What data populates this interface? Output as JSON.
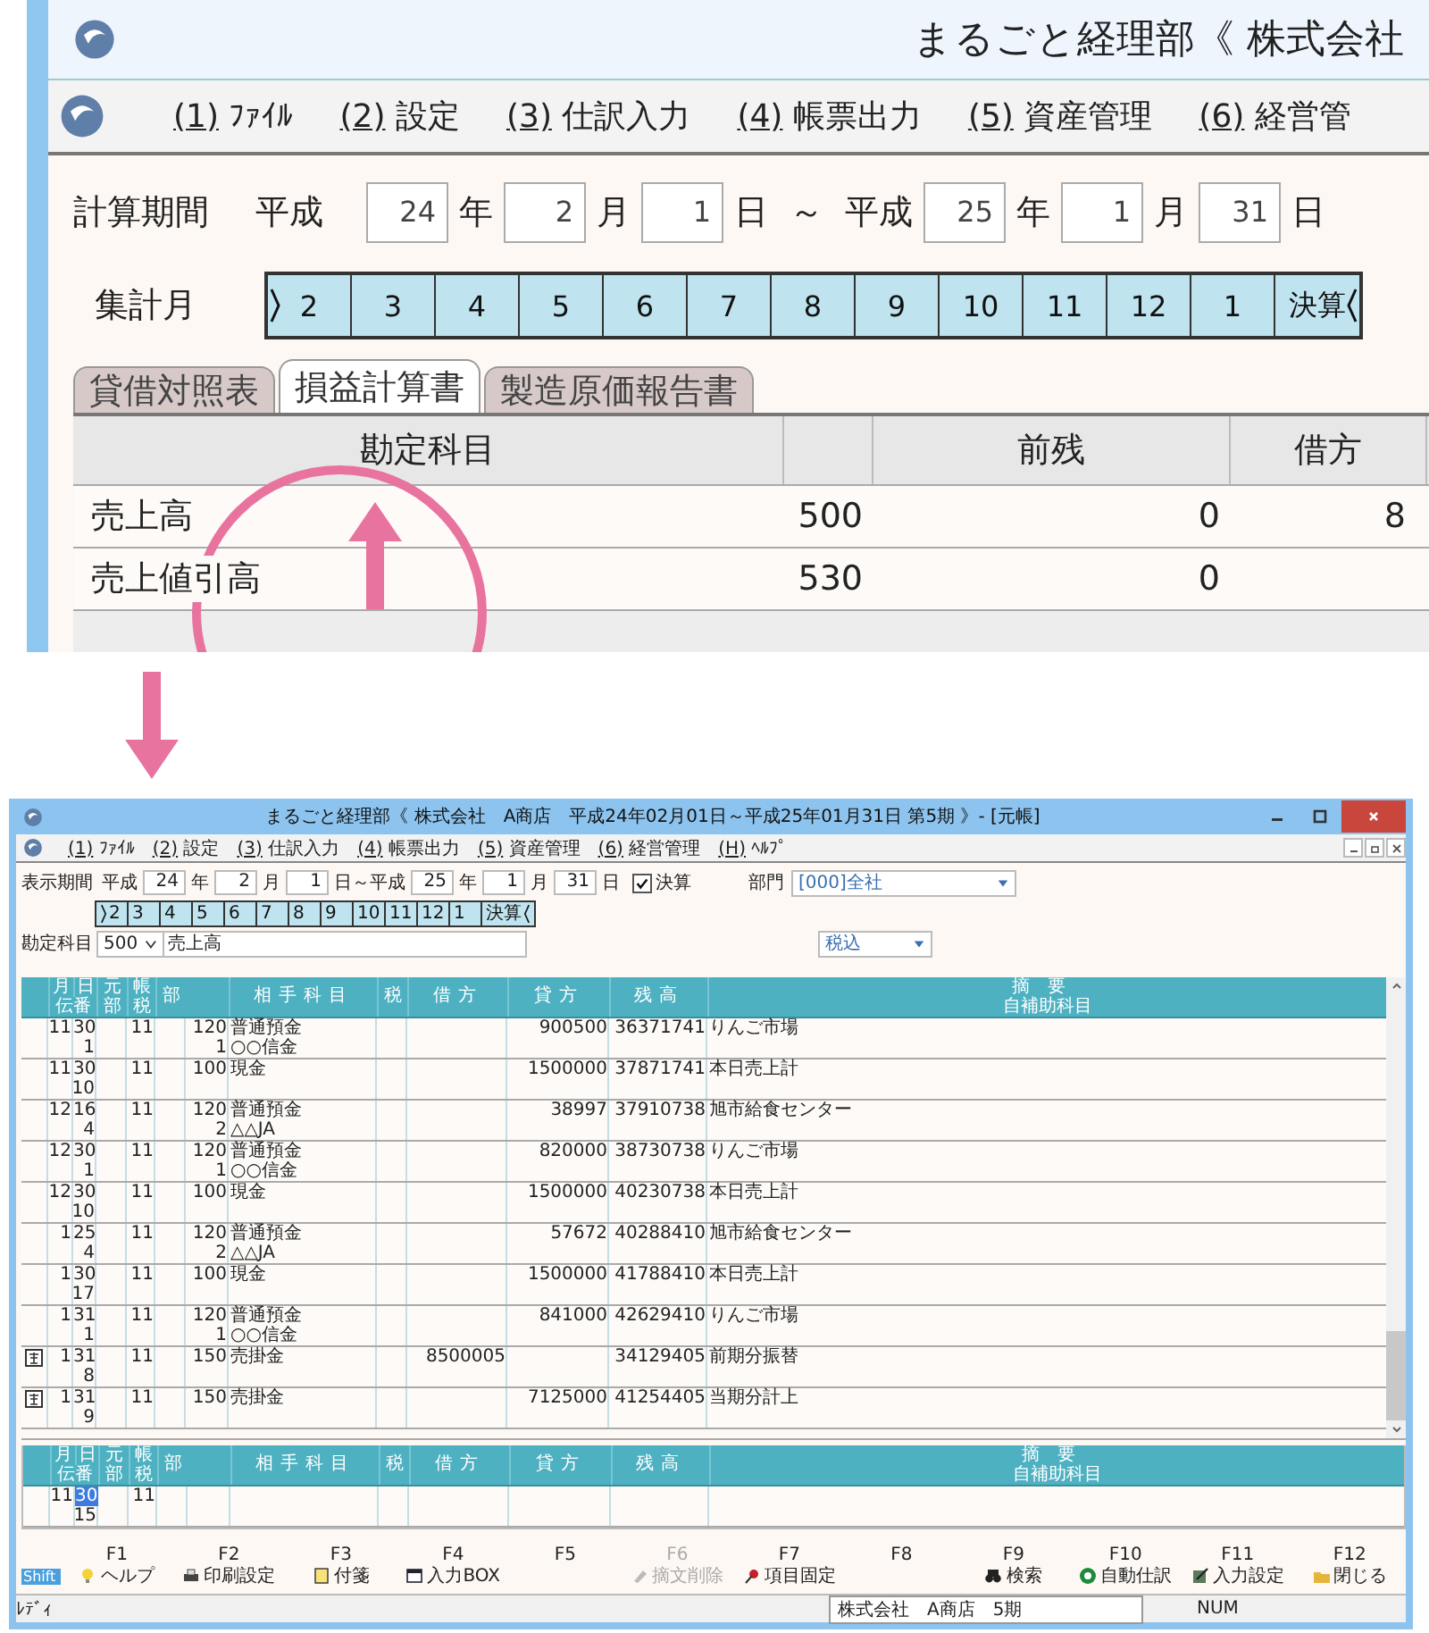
{
  "callout": {
    "title": "まるごと経理部《 株式会社",
    "menu": [
      {
        "key": "(1)",
        "label": "ﾌｧｲﾙ"
      },
      {
        "key": "(2)",
        "label": "設定"
      },
      {
        "key": "(3)",
        "label": "仕訳入力"
      },
      {
        "key": "(4)",
        "label": "帳票出力"
      },
      {
        "key": "(5)",
        "label": "資産管理"
      },
      {
        "key": "(6)",
        "label": "経営管"
      }
    ],
    "period": {
      "label": "計算期間",
      "parts": [
        {
          "kind": "text",
          "text": "平成"
        },
        {
          "kind": "field",
          "text": "24"
        },
        {
          "kind": "text",
          "text": "年"
        },
        {
          "kind": "field",
          "text": "2"
        },
        {
          "kind": "text",
          "text": "月"
        },
        {
          "kind": "field",
          "text": "1"
        },
        {
          "kind": "text",
          "text": "日"
        },
        {
          "kind": "text",
          "text": "～"
        },
        {
          "kind": "text",
          "text": "平成"
        },
        {
          "kind": "field",
          "text": "25"
        },
        {
          "kind": "text",
          "text": "年"
        },
        {
          "kind": "field",
          "text": "1"
        },
        {
          "kind": "text",
          "text": "月"
        },
        {
          "kind": "field",
          "text": "31"
        },
        {
          "kind": "text",
          "text": "日"
        }
      ]
    },
    "months": {
      "label": "集計月",
      "items": [
        {
          "label": "2",
          "range_start": true,
          "range_end": false
        },
        {
          "label": "3",
          "range_start": false,
          "range_end": false
        },
        {
          "label": "4",
          "range_start": false,
          "range_end": false
        },
        {
          "label": "5",
          "range_start": false,
          "range_end": false
        },
        {
          "label": "6",
          "range_start": false,
          "range_end": false
        },
        {
          "label": "7",
          "range_start": false,
          "range_end": false
        },
        {
          "label": "8",
          "range_start": false,
          "range_end": false
        },
        {
          "label": "9",
          "range_start": false,
          "range_end": false
        },
        {
          "label": "10",
          "range_start": false,
          "range_end": false
        },
        {
          "label": "11",
          "range_start": false,
          "range_end": false
        },
        {
          "label": "12",
          "range_start": false,
          "range_end": false
        },
        {
          "label": "1",
          "range_start": false,
          "range_end": false
        },
        {
          "label": "決算",
          "range_start": false,
          "range_end": true
        }
      ]
    },
    "tabs": [
      {
        "label": "貸借対照表",
        "selected": false
      },
      {
        "label": "損益計算書",
        "selected": true
      },
      {
        "label": "製造原価報告書",
        "selected": false
      }
    ],
    "table": {
      "columns": [
        "勘定科目",
        "前残",
        "借方"
      ],
      "rows": [
        {
          "name": "売上高",
          "code": "500",
          "prev": "0",
          "debit": "8"
        },
        {
          "name": "売上値引高",
          "code": "530",
          "prev": "0",
          "debit": ""
        }
      ]
    }
  },
  "window": {
    "title": "まるごと経理部《 株式会社　A商店　平成24年02月01日～平成25年01月31日 第5期 》- [元帳]",
    "menu": [
      {
        "key": "(1)",
        "label": "ﾌｧｲﾙ"
      },
      {
        "key": "(2)",
        "label": "設定"
      },
      {
        "key": "(3)",
        "label": "仕訳入力"
      },
      {
        "key": "(4)",
        "label": "帳票出力"
      },
      {
        "key": "(5)",
        "label": "資産管理"
      },
      {
        "key": "(6)",
        "label": "経営管理"
      },
      {
        "key": "(H)",
        "label": "ﾍﾙﾌﾟ"
      }
    ],
    "period": {
      "label": "表示期間",
      "parts": [
        {
          "kind": "text",
          "text": "平成"
        },
        {
          "kind": "field",
          "text": "24"
        },
        {
          "kind": "text",
          "text": "年"
        },
        {
          "kind": "field",
          "text": "2"
        },
        {
          "kind": "text",
          "text": "月"
        },
        {
          "kind": "field",
          "text": "1"
        },
        {
          "kind": "text",
          "text": "日～平成"
        },
        {
          "kind": "field",
          "text": "25"
        },
        {
          "kind": "text",
          "text": "年"
        },
        {
          "kind": "field",
          "text": "1"
        },
        {
          "kind": "text",
          "text": "月"
        },
        {
          "kind": "field",
          "text": "31"
        },
        {
          "kind": "text",
          "text": "日"
        }
      ]
    },
    "settle": {
      "label": "決算",
      "checked": true
    },
    "dept": {
      "label": "部門",
      "value": "[000]全社"
    },
    "months": [
      {
        "label": "2",
        "range_start": true,
        "range_end": false
      },
      {
        "label": "3",
        "range_start": false,
        "range_end": false
      },
      {
        "label": "4",
        "range_start": false,
        "range_end": false
      },
      {
        "label": "5",
        "range_start": false,
        "range_end": false
      },
      {
        "label": "6",
        "range_start": false,
        "range_end": false
      },
      {
        "label": "7",
        "range_start": false,
        "range_end": false
      },
      {
        "label": "8",
        "range_start": false,
        "range_end": false
      },
      {
        "label": "9",
        "range_start": false,
        "range_end": false
      },
      {
        "label": "10",
        "range_start": false,
        "range_end": false
      },
      {
        "label": "11",
        "range_start": false,
        "range_end": false
      },
      {
        "label": "12",
        "range_start": false,
        "range_end": false
      },
      {
        "label": "1",
        "range_start": false,
        "range_end": false
      },
      {
        "label": "決算",
        "range_start": false,
        "range_end": true
      }
    ],
    "account": {
      "label": "勘定科目",
      "code": "500",
      "name": "売上高",
      "tax_mode": "税込"
    },
    "header": {
      "month": "月",
      "day": "日",
      "moto": "元",
      "ledger": "帳",
      "voucher": "伝番",
      "dept": "部",
      "tax": "税",
      "dept2": "部",
      "account": "相手科目",
      "zei": "税",
      "debit": "借方",
      "credit": "貸方",
      "balance": "残高",
      "summary": "摘要",
      "sub": "自補助科目"
    },
    "rows": [
      {
        "flagged": false,
        "month": "11",
        "day": "30",
        "voucher": "1",
        "ledger": "11",
        "code": "120",
        "account": "普通預金",
        "sub_code": "1",
        "sub_name": "○○信金",
        "debit": "",
        "credit": "900500",
        "balance": "36371741",
        "summary": "りんご市場"
      },
      {
        "flagged": false,
        "month": "11",
        "day": "30",
        "voucher": "10",
        "ledger": "11",
        "code": "100",
        "account": "現金",
        "debit": "",
        "credit": "1500000",
        "balance": "37871741",
        "summary": "本日売上計"
      },
      {
        "flagged": false,
        "month": "12",
        "day": "16",
        "voucher": "4",
        "ledger": "11",
        "code": "120",
        "account": "普通預金",
        "sub_code": "2",
        "sub_name": "△△JA",
        "debit": "",
        "credit": "38997",
        "balance": "37910738",
        "summary": "旭市給食センター"
      },
      {
        "flagged": false,
        "month": "12",
        "day": "30",
        "voucher": "1",
        "ledger": "11",
        "code": "120",
        "account": "普通預金",
        "sub_code": "1",
        "sub_name": "○○信金",
        "debit": "",
        "credit": "820000",
        "balance": "38730738",
        "summary": "りんご市場"
      },
      {
        "flagged": false,
        "month": "12",
        "day": "30",
        "voucher": "10",
        "ledger": "11",
        "code": "100",
        "account": "現金",
        "debit": "",
        "credit": "1500000",
        "balance": "40230738",
        "summary": "本日売上計"
      },
      {
        "flagged": false,
        "month": "1",
        "day": "25",
        "voucher": "4",
        "ledger": "11",
        "code": "120",
        "account": "普通預金",
        "sub_code": "2",
        "sub_name": "△△JA",
        "debit": "",
        "credit": "57672",
        "balance": "40288410",
        "summary": "旭市給食センター"
      },
      {
        "flagged": false,
        "month": "1",
        "day": "30",
        "voucher": "17",
        "ledger": "11",
        "code": "100",
        "account": "現金",
        "debit": "",
        "credit": "1500000",
        "balance": "41788410",
        "summary": "本日売上計"
      },
      {
        "flagged": false,
        "month": "1",
        "day": "31",
        "voucher": "1",
        "ledger": "11",
        "code": "120",
        "account": "普通預金",
        "sub_code": "1",
        "sub_name": "○○信金",
        "debit": "",
        "credit": "841000",
        "balance": "42629410",
        "summary": "りんご市場"
      },
      {
        "flagged": true,
        "month": "1",
        "day": "31",
        "voucher": "8",
        "ledger": "11",
        "code": "150",
        "account": "売掛金",
        "debit": "8500005",
        "credit": "",
        "balance": "34129405",
        "summary": "前期分振替"
      },
      {
        "flagged": true,
        "month": "1",
        "day": "31",
        "voucher": "9",
        "ledger": "11",
        "code": "150",
        "account": "売掛金",
        "debit": "",
        "credit": "7125000",
        "balance": "41254405",
        "summary": "当期分計上"
      }
    ],
    "entry_header": {
      "month": "月",
      "day": "日",
      "moto": "元",
      "ledger": "帳",
      "voucher": "伝番",
      "dept": "部",
      "tax": "税",
      "dept2": "部",
      "account": "相手科目",
      "zei": "税",
      "debit": "借方",
      "credit": "貸方",
      "balance": "残高",
      "summary": "摘要",
      "sub": "自補助科目"
    },
    "entry": {
      "month": "11",
      "day": "30",
      "day_selected": true,
      "ledger": "11",
      "voucher": "15"
    },
    "shift": "Shift",
    "fkeys": [
      {
        "key": "F1",
        "label": "ヘルプ",
        "kind": "bulb",
        "disabled": false
      },
      {
        "key": "F2",
        "label": "印刷設定",
        "kind": "printer",
        "disabled": false
      },
      {
        "key": "F3",
        "label": "付箋",
        "kind": "note",
        "disabled": false
      },
      {
        "key": "F4",
        "label": "入力BOX",
        "kind": "window",
        "disabled": false
      },
      {
        "key": "F5",
        "kind": "blank",
        "disabled": false
      },
      {
        "key": "F6",
        "label": "摘文削除",
        "kind": "eraser",
        "disabled": true
      },
      {
        "key": "F7",
        "label": "項目固定",
        "kind": "pin",
        "disabled": false
      },
      {
        "key": "F8",
        "kind": "blank",
        "disabled": false
      },
      {
        "key": "F9",
        "label": "検索",
        "kind": "binoculars",
        "disabled": false
      },
      {
        "key": "F10",
        "label": "自動仕訳",
        "kind": "auto",
        "disabled": false
      },
      {
        "key": "F11",
        "label": "入力設定",
        "kind": "settings",
        "disabled": false
      },
      {
        "key": "F12",
        "label": "閉じる",
        "kind": "folder",
        "disabled": false
      }
    ],
    "status": {
      "state": "ﾚﾃﾞｨ",
      "company": "株式会社　A商店　5期",
      "num": "NUM"
    }
  }
}
